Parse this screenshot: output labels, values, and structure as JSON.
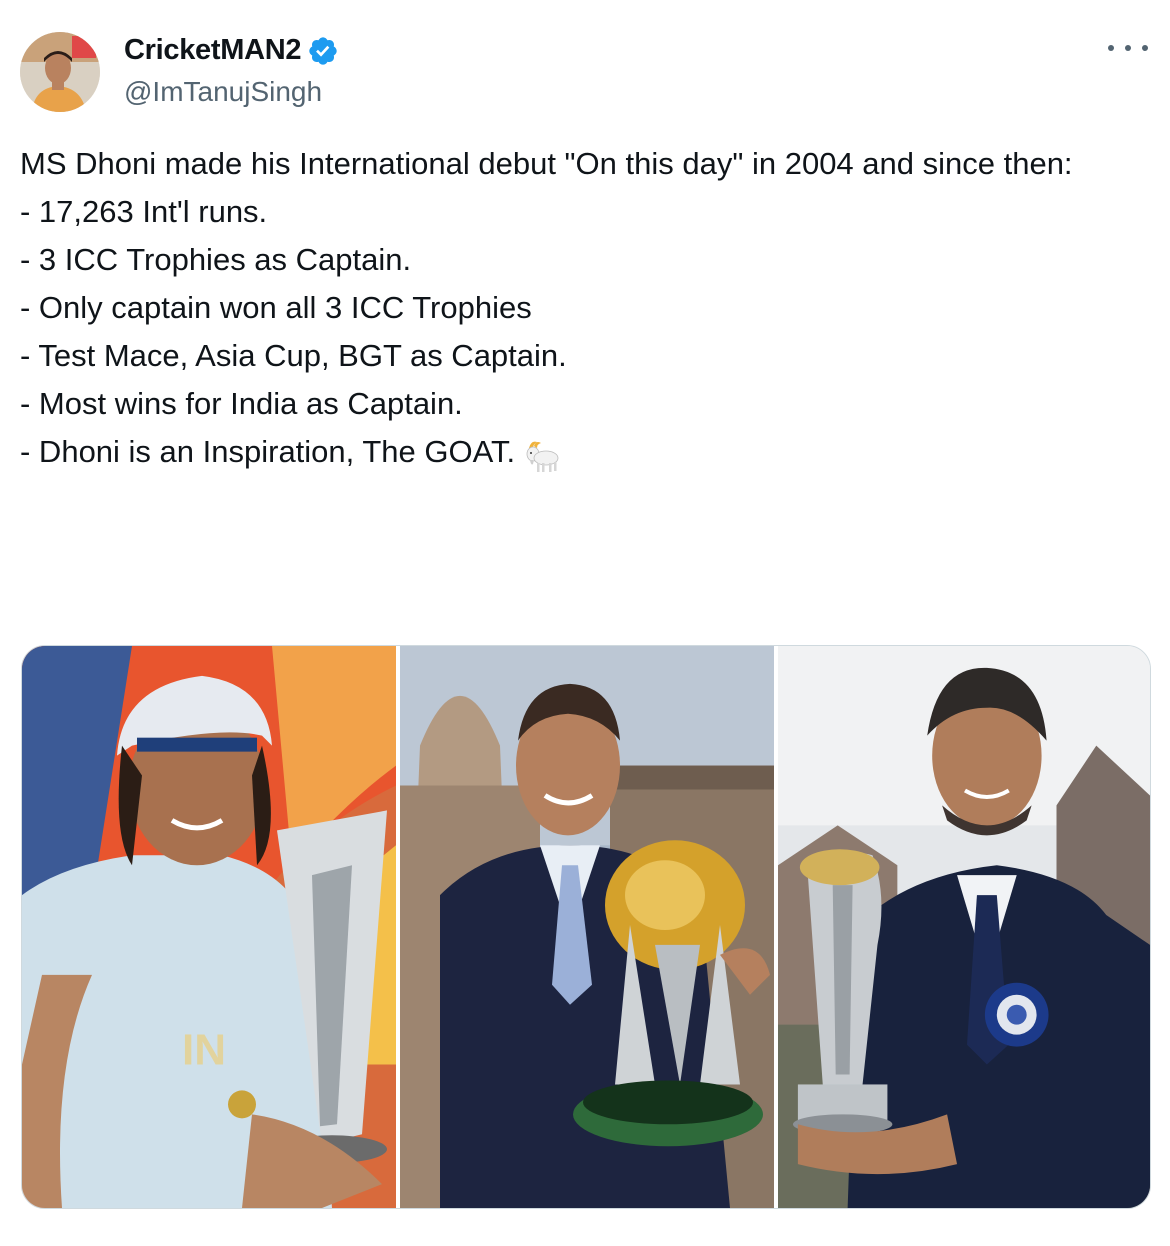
{
  "author": {
    "display_name": "CricketMAN2",
    "handle": "@ImTanujSingh",
    "verified_icon": "verified-badge-icon",
    "avatar": "profile-avatar"
  },
  "more_icon": "more-options-icon",
  "tweet": {
    "lines": [
      "MS Dhoni made his International debut \"On this day\" in 2004 and since then:",
      "",
      "- 17,263 Int'l runs.",
      "- 3 ICC Trophies as Captain.",
      "- Only captain won all 3 ICC Trophies",
      "- Test Mace, Asia Cup, BGT as Captain.",
      "- Most wins for India as Captain.",
      "",
      "- Dhoni is an Inspiration, The GOAT."
    ],
    "emoji": "goat-emoji"
  },
  "media": {
    "images": [
      "t20-world-cup-trophy-photo",
      "odi-world-cup-trophy-photo",
      "champions-trophy-photo"
    ]
  },
  "colors": {
    "verified_blue": "#1d9bf0",
    "secondary_text": "#536471",
    "border": "#cfd9de"
  }
}
